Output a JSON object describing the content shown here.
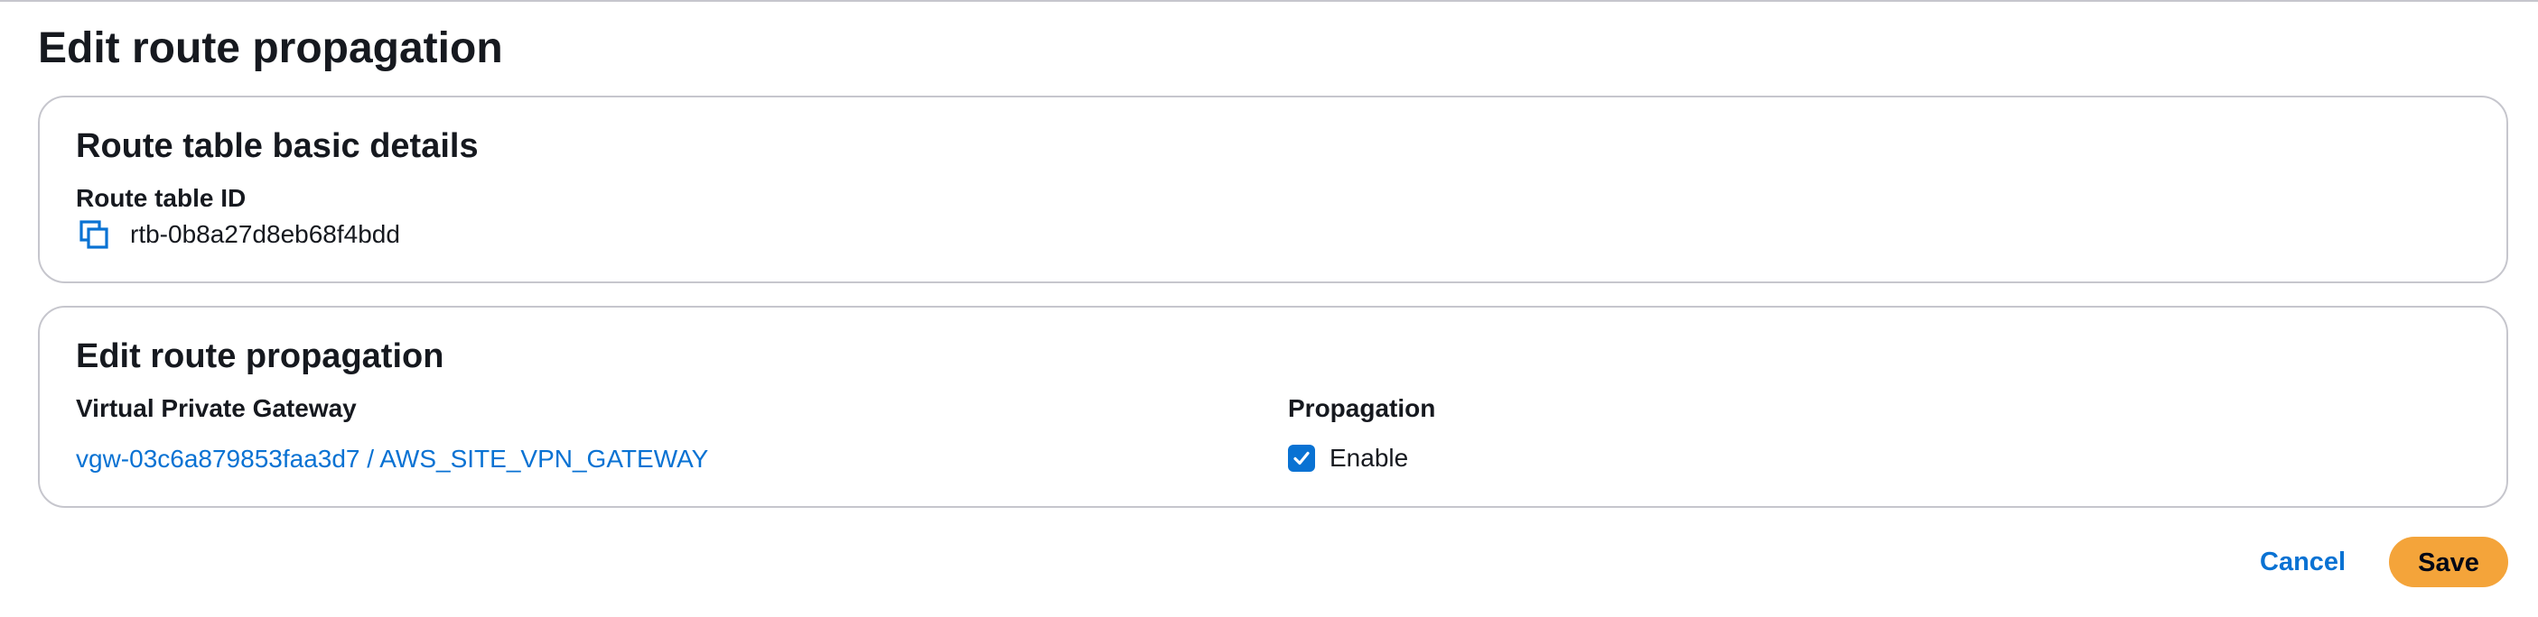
{
  "page": {
    "title": "Edit route propagation"
  },
  "details_card": {
    "title": "Route table basic details",
    "route_table_id_label": "Route table ID",
    "route_table_id_value": "rtb-0b8a27d8eb68f4bdd",
    "copy_icon": "copy-icon"
  },
  "propagation_card": {
    "title": "Edit route propagation",
    "gateway_column_label": "Virtual Private Gateway",
    "propagation_column_label": "Propagation",
    "rows": [
      {
        "gateway": "vgw-03c6a879853faa3d7 / AWS_SITE_VPN_GATEWAY",
        "propagation_label": "Enable",
        "propagation_enabled": true
      }
    ]
  },
  "actions": {
    "cancel_label": "Cancel",
    "save_label": "Save"
  },
  "colors": {
    "link": "#0972d3",
    "primary_button": "#f4a43a",
    "border": "#c6c6cd",
    "text": "#16191f"
  }
}
